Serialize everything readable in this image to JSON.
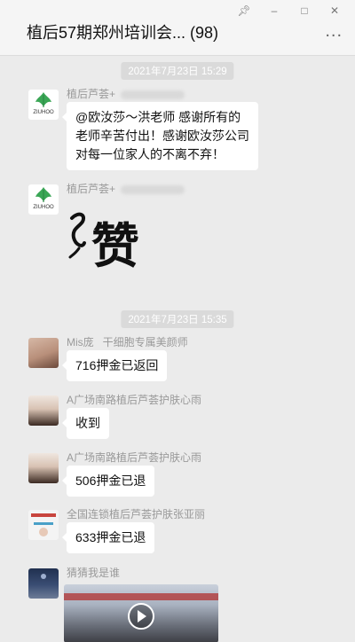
{
  "window": {
    "title": "植后57期郑州培训会... (98)",
    "pin_icon": "pin-icon",
    "minimize_icon": "minimize-icon",
    "maximize_icon": "maximize-icon",
    "close_icon": "close-icon",
    "more_icon": "more-icon",
    "more_text": "..."
  },
  "timestamps": [
    "2021年7月23日 15:29",
    "2021年7月23日 15:35"
  ],
  "messages": [
    {
      "sender": "植后芦荟+",
      "text": "@欧汝莎～洪老师 感谢所有的\n老师辛苦付出！感谢欧汝莎公司\n对每一位家人的不离不弃！",
      "avatar": "ziuhoo-logo"
    },
    {
      "sender": "植后芦荟+",
      "sticker_text": "赞",
      "avatar": "ziuhoo-logo"
    },
    {
      "sender": "Mis庞   干细胞专属美颜师",
      "text": "716押金已返回",
      "avatar": "woman-portrait"
    },
    {
      "sender": "A广场南路植后芦荟护肤心雨",
      "text": "收到",
      "avatar": "woman-face"
    },
    {
      "sender": "A广场南路植后芦荟护肤心雨",
      "text": "506押金已退",
      "avatar": "woman-face"
    },
    {
      "sender": "全国连锁植后芦荟护肤张亚丽",
      "text": "633押金已退",
      "avatar": "poster"
    },
    {
      "sender": "猜猜我是谁",
      "avatar": "night-sky",
      "video": true
    }
  ],
  "logo_text": "ZIUHOO",
  "colors": {
    "bg": "#ebebeb",
    "bubble": "#ffffff",
    "timestamp_bg": "#dadada",
    "brand_green": "#3aa655"
  }
}
